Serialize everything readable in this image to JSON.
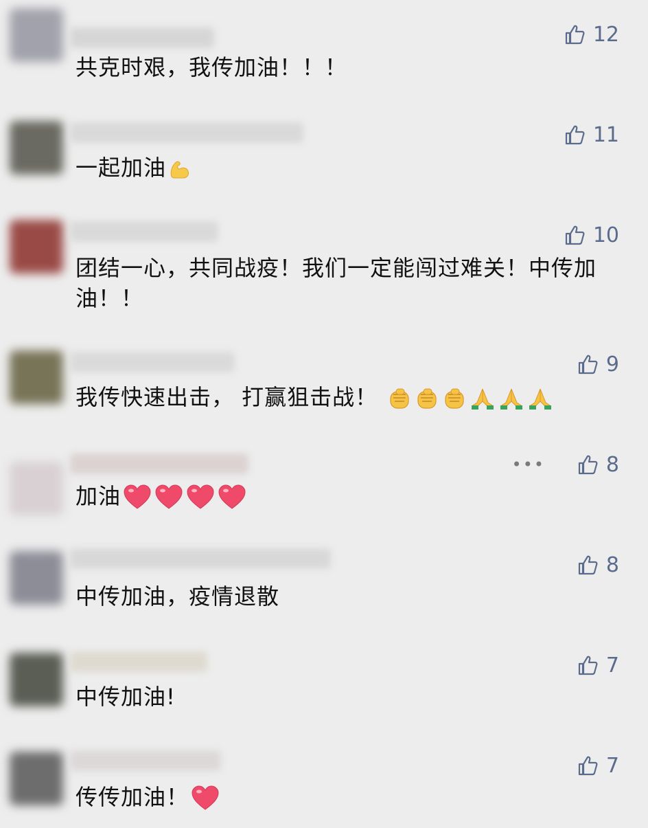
{
  "comments": [
    {
      "text": "共克时艰，我传加油！！！",
      "likes": "12",
      "avatar_color": "#a2a2ac",
      "name_color": "#d6d6d6",
      "emojis": []
    },
    {
      "text": "一起加油",
      "likes": "11",
      "avatar_color": "#6a6a62",
      "name_color": "#d9d9d9",
      "emojis": [
        "muscle-icon"
      ]
    },
    {
      "text": "团结一心，共同战疫！我们一定能闯过难关！中传加油！！",
      "likes": "10",
      "avatar_color": "#9a4a46",
      "name_color": "#d9d9d9",
      "emojis": []
    },
    {
      "text": "我传快速出击， 打赢狙击战！",
      "likes": "9",
      "avatar_color": "#787458",
      "name_color": "#dadada",
      "emojis": [
        "fist-icon",
        "fist-icon",
        "fist-icon",
        "pray-icon",
        "pray-icon",
        "pray-icon"
      ]
    },
    {
      "text": "加油",
      "likes": "8",
      "avatar_color": "#d8d0d2",
      "name_color": "#dcd2d2",
      "more_label": "•••",
      "emojis": [
        "heart-icon",
        "heart-icon",
        "heart-icon",
        "heart-icon"
      ]
    },
    {
      "text": "中传加油，疫情退散",
      "likes": "8",
      "avatar_color": "#8d8d98",
      "name_color": "#d8d8d8",
      "emojis": []
    },
    {
      "text": "中传加油!",
      "likes": "7",
      "avatar_color": "#5b5e55",
      "name_color": "#dedad0",
      "emojis": []
    },
    {
      "text": "传传加油！",
      "likes": "7",
      "avatar_color": "#6d6d6d",
      "name_color": "#dcd8d8",
      "emojis": [
        "heart-icon"
      ]
    }
  ],
  "colors": {
    "background": "#ededed",
    "like": "#5b6b8c",
    "text": "#111111"
  }
}
